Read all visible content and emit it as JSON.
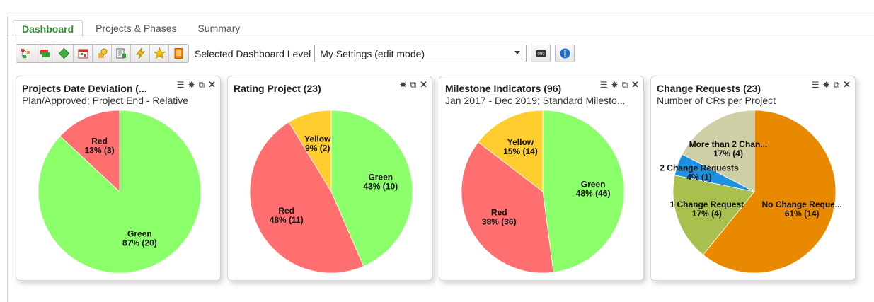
{
  "tabs": [
    {
      "label": "Dashboard",
      "active": true
    },
    {
      "label": "Projects & Phases",
      "active": false
    },
    {
      "label": "Summary",
      "active": false
    }
  ],
  "toolbar": {
    "icons": [
      "tree-icon",
      "layers-icon",
      "diamond-icon",
      "calendar-icon",
      "money-icon",
      "report-icon",
      "lightning-icon",
      "star-icon",
      "document-icon"
    ],
    "level_label": "Selected Dashboard Level",
    "level_value": "My Settings (edit mode)",
    "extra_buttons": [
      "counter-icon",
      "info-icon"
    ]
  },
  "colors": {
    "green": "#8aff6a",
    "red": "#ff6f6f",
    "yellow": "#ffcd2e",
    "orange": "#e88900",
    "olive": "#a8c04e",
    "blue": "#1e90e0",
    "beige": "#cfcfa6",
    "tab_active": "#2e8b2e"
  },
  "widgets": [
    {
      "title": "Projects Date Deviation (...",
      "subtitle": "Plan/Approved; Project End - Relative",
      "chart_data": {
        "type": "pie",
        "slices": [
          {
            "label": "Green",
            "value_text": "87% (20)",
            "value": 20,
            "color": "green"
          },
          {
            "label": "Red",
            "value_text": "13% (3)",
            "value": 3,
            "color": "red"
          }
        ]
      }
    },
    {
      "title": "Rating Project (23)",
      "subtitle": "",
      "chart_data": {
        "type": "pie",
        "slices": [
          {
            "label": "Green",
            "value_text": "43% (10)",
            "value": 10,
            "color": "green"
          },
          {
            "label": "Red",
            "value_text": "48% (11)",
            "value": 11,
            "color": "red"
          },
          {
            "label": "Yellow",
            "value_text": "9% (2)",
            "value": 2,
            "color": "yellow"
          }
        ]
      }
    },
    {
      "title": "Milestone Indicators (96)",
      "subtitle": "Jan 2017 - Dec 2019; Standard Milesto...",
      "chart_data": {
        "type": "pie",
        "slices": [
          {
            "label": "Green",
            "value_text": "48% (46)",
            "value": 46,
            "color": "green"
          },
          {
            "label": "Red",
            "value_text": "38% (36)",
            "value": 36,
            "color": "red"
          },
          {
            "label": "Yellow",
            "value_text": "15% (14)",
            "value": 14,
            "color": "yellow"
          }
        ]
      }
    },
    {
      "title": "Change Requests (23)",
      "subtitle": "Number of CRs per Project",
      "chart_data": {
        "type": "pie",
        "slices": [
          {
            "label": "No Change Reque...",
            "value_text": "61% (14)",
            "value": 14,
            "color": "orange"
          },
          {
            "label": "1 Change Request",
            "value_text": "17% (4)",
            "value": 4,
            "color": "olive"
          },
          {
            "label": "2 Change Requests",
            "value_text": "4% (1)",
            "value": 1,
            "color": "blue"
          },
          {
            "label": "More than 2 Chan...",
            "value_text": "17% (4)",
            "value": 4,
            "color": "beige"
          }
        ]
      }
    }
  ]
}
